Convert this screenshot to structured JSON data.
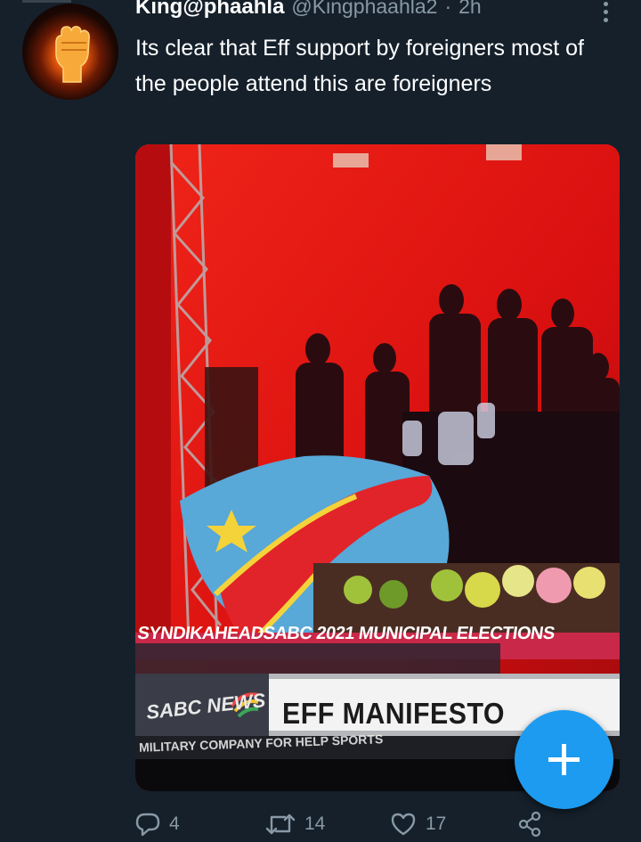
{
  "tweet": {
    "display_name": "King@phaahla",
    "handle": "@Kingphaahla2",
    "separator": "·",
    "time": "2h",
    "text": "Its clear that Eff support by foreigners most of the people attend this are foreigners"
  },
  "media": {
    "ticker": "SYNDIKAHEADSABC 2021 MUNICIPAL ELECTIONS",
    "channel": "SABC NEWS",
    "headline": "EFF MANIFESTO",
    "crawl": "MILITARY COMPANY FOR HELP   SPORTS"
  },
  "actions": {
    "reply_count": "4",
    "retweet_count": "14",
    "like_count": "17"
  },
  "icons": {
    "more": "more-vertical-icon",
    "reply": "reply-icon",
    "retweet": "retweet-icon",
    "like": "heart-icon",
    "share": "share-icon",
    "compose": "plus-icon"
  },
  "colors": {
    "background": "#15202b",
    "secondary_text": "#8899a6",
    "accent": "#1d9bf0"
  }
}
